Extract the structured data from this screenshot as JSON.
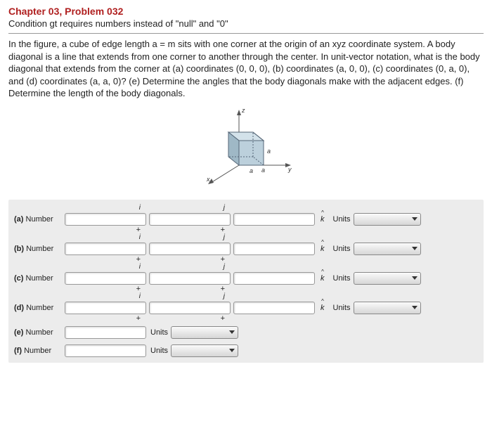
{
  "header": {
    "title": "Chapter 03, Problem 032",
    "subtitle": "Condition gt requires numbers instead of \"null\" and \"0\""
  },
  "problem": {
    "text": "In the figure, a cube of edge length a = m sits with one corner at the origin of an xyz coordinate system. A body diagonal is a line that extends from one corner to another through the center. In unit-vector notation, what is the body diagonal that extends from the corner at (a) coordinates (0, 0, 0), (b) coordinates (a, 0, 0), (c) coordinates (0, a, 0), and (d) coordinates (a, a, 0)? (e) Determine the angles that the body diagonals make with the adjacent edges. (f) Determine the length of the body diagonals."
  },
  "figure": {
    "axis_x": "x",
    "axis_y": "y",
    "axis_z": "z",
    "edge_label": "a"
  },
  "hats": {
    "i": "i",
    "j": "j",
    "k": "k"
  },
  "ops": {
    "plus": "+"
  },
  "labels": {
    "number": "Number",
    "units": "Units"
  },
  "rows": {
    "a": {
      "letter": "(a)",
      "i": "",
      "j": "",
      "k": "",
      "units": ""
    },
    "b": {
      "letter": "(b)",
      "i": "",
      "j": "",
      "k": "",
      "units": ""
    },
    "c": {
      "letter": "(c)",
      "i": "",
      "j": "",
      "k": "",
      "units": ""
    },
    "d": {
      "letter": "(d)",
      "i": "",
      "j": "",
      "k": "",
      "units": ""
    },
    "e": {
      "letter": "(e)",
      "value": "",
      "units": ""
    },
    "f": {
      "letter": "(f)",
      "value": "",
      "units": ""
    }
  }
}
